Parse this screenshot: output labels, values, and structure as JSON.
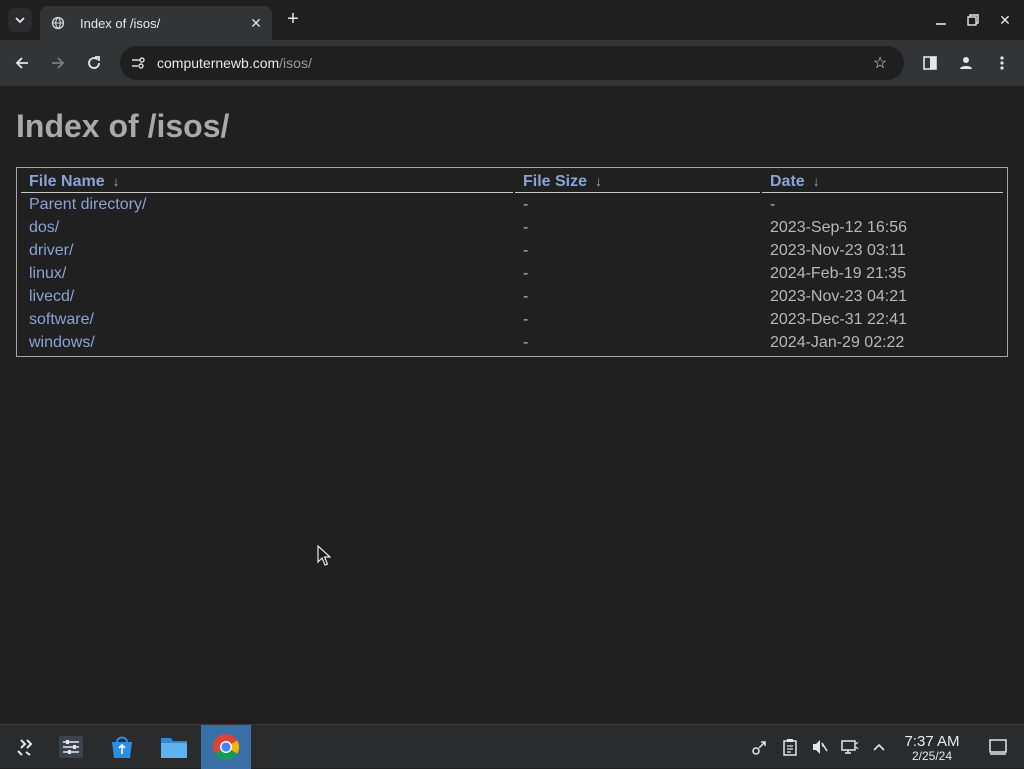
{
  "browser": {
    "tab_title": "Index of /isos/",
    "tab_favicon": "globe-icon",
    "url_host": "computernewb.com",
    "url_path": "/isos/"
  },
  "page": {
    "heading": "Index of /isos/",
    "columns": {
      "name": "File Name",
      "size": "File Size",
      "date": "Date",
      "sort_arrow": "↓"
    },
    "rows": [
      {
        "name": "Parent directory/",
        "size": "-",
        "date": "-"
      },
      {
        "name": "dos/",
        "size": "-",
        "date": "2023-Sep-12 16:56"
      },
      {
        "name": "driver/",
        "size": "-",
        "date": "2023-Nov-23 03:11"
      },
      {
        "name": "linux/",
        "size": "-",
        "date": "2024-Feb-19 21:35"
      },
      {
        "name": "livecd/",
        "size": "-",
        "date": "2023-Nov-23 04:21"
      },
      {
        "name": "software/",
        "size": "-",
        "date": "2023-Dec-31 22:41"
      },
      {
        "name": "windows/",
        "size": "-",
        "date": "2024-Jan-29 02:22"
      }
    ]
  },
  "taskbar": {
    "apps": [
      "launcher-icon",
      "settings-icon",
      "store-icon",
      "file-manager-icon",
      "chrome-icon"
    ],
    "clock_time": "7:37 AM",
    "clock_date": "2/25/24"
  },
  "colors": {
    "link": "#8aa4d6",
    "text": "#b8b8b8",
    "heading": "#a9a9a9",
    "background": "#202020",
    "active_app": "#3a6fa8"
  }
}
